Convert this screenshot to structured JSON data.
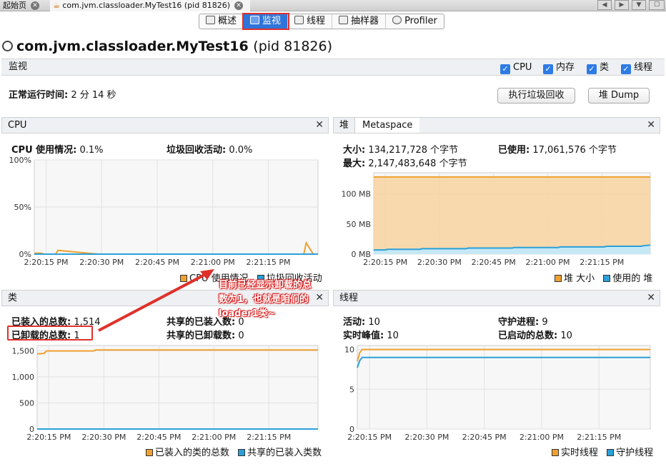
{
  "doc_tabs": [
    {
      "label": "起始页"
    },
    {
      "label": "com.jvm.classloader.MyTest16 (pid 81826)"
    }
  ],
  "view_tabs": [
    {
      "label": "概述",
      "icon": "overview-icon",
      "active": false
    },
    {
      "label": "监视",
      "icon": "monitor-icon",
      "active": true
    },
    {
      "label": "线程",
      "icon": "threads-icon",
      "active": false
    },
    {
      "label": "抽样器",
      "icon": "sampler-icon",
      "active": false
    },
    {
      "label": "Profiler",
      "icon": "profiler-icon",
      "active": false
    }
  ],
  "app": {
    "name": "com.jvm.classloader.MyTest16",
    "pid": "(pid 81826)"
  },
  "monitor": {
    "header": "监视",
    "checks": [
      {
        "label": "CPU"
      },
      {
        "label": "内存"
      },
      {
        "label": "类"
      },
      {
        "label": "线程"
      }
    ],
    "uptime_label": "正常运行时间:",
    "uptime_value": "2 分 14 秒",
    "gc_button": "执行垃圾回收",
    "dump_button": "堆 Dump"
  },
  "cpu": {
    "title": "CPU",
    "usage_label": "CPU 使用情况:",
    "usage_value": "0.1%",
    "gc_label": "垃圾回收活动:",
    "gc_value": "0.0%",
    "legend": [
      "CPU 使用情况",
      "垃圾回收活动"
    ]
  },
  "heap": {
    "tab_heap": "堆",
    "tab_meta": "Metaspace",
    "size_label": "大小:",
    "size_value": "134,217,728 个字节",
    "used_label": "已使用:",
    "used_value": "17,061,576 个字节",
    "max_label": "最大:",
    "max_value": "2,147,483,648 个字节",
    "legend": [
      "堆 大小",
      "使用的 堆"
    ]
  },
  "classes": {
    "title": "类",
    "loaded_label": "已装入的总数:",
    "loaded_value": "1,514",
    "unloaded_label": "已卸载的总数:",
    "unloaded_value": "1",
    "shared_loaded_label": "共享的已装入数:",
    "shared_loaded_value": "0",
    "shared_unloaded_label": "共享的已卸载数:",
    "shared_unloaded_value": "0",
    "legend": [
      "已装入的类的总数",
      "共享的已装入类数"
    ]
  },
  "threads": {
    "title": "线程",
    "live_label": "活动:",
    "live_value": "10",
    "peak_label": "实时峰值:",
    "peak_value": "10",
    "daemon_label": "守护进程:",
    "daemon_value": "9",
    "started_label": "已启动的总数:",
    "started_value": "10",
    "legend": [
      "实时线程",
      "守护线程"
    ]
  },
  "annotation": {
    "text": "目前已经显示卸载的总数为1，也就是咱们的loader1类~"
  },
  "colors": {
    "orange": "#f0a030",
    "blue": "#2aa0d8",
    "accent": "#2f75d9",
    "red": "#e0302a"
  },
  "chart_data": [
    {
      "id": "cpu",
      "type": "line",
      "ylim": [
        0,
        100
      ],
      "yticks": [
        "100%",
        "50%",
        "0%"
      ],
      "ytick_vals": [
        100,
        50,
        0
      ],
      "xticks": [
        "2:20:15 PM",
        "2:20:30 PM",
        "2:20:45 PM",
        "2:21:00 PM",
        "2:21:15 PM"
      ],
      "series": [
        {
          "name": "CPU 使用情况",
          "color": "#f0a030",
          "x": [
            0,
            3,
            4,
            5,
            6,
            7,
            9,
            10,
            27,
            28,
            29,
            30,
            31,
            87,
            90,
            100,
            112,
            114,
            115,
            118,
            120
          ],
          "y": [
            1,
            1,
            0,
            0,
            0,
            0,
            0,
            4,
            0,
            0,
            0,
            0,
            0,
            0,
            0,
            0,
            0,
            0,
            12,
            0,
            0
          ]
        },
        {
          "name": "垃圾回收活动",
          "color": "#2aa0d8",
          "x": [
            0,
            120
          ],
          "y": [
            0,
            0
          ]
        }
      ]
    },
    {
      "id": "heap",
      "type": "area",
      "ylim": [
        0,
        135
      ],
      "yticks": [
        "100 MB",
        "50 MB",
        "0 MB"
      ],
      "ytick_vals": [
        100,
        50,
        0
      ],
      "xticks": [
        "2:20:15 PM",
        "2:20:30 PM",
        "2:20:45 PM",
        "2:21:00 PM",
        "2:21:15 PM"
      ],
      "series": [
        {
          "name": "堆 大小",
          "color": "#f0a030",
          "x": [
            0,
            120
          ],
          "y": [
            128,
            128
          ]
        },
        {
          "name": "使用的 堆",
          "color": "#2aa0d8",
          "x": [
            0,
            5,
            6,
            20,
            21,
            40,
            41,
            60,
            61,
            80,
            81,
            100,
            101,
            116,
            117,
            120
          ],
          "y": [
            7,
            7,
            8,
            8,
            9,
            9,
            10,
            10,
            11,
            11,
            12,
            12,
            13,
            13,
            14,
            15
          ]
        }
      ]
    },
    {
      "id": "classes",
      "type": "line",
      "ylim": [
        0,
        1600
      ],
      "yticks": [
        "1,500",
        "1,000",
        "500",
        "0"
      ],
      "ytick_vals": [
        1500,
        1000,
        500,
        0
      ],
      "xticks": [
        "2:20:15 PM",
        "2:20:30 PM",
        "2:20:45 PM",
        "2:21:00 PM",
        "2:21:15 PM"
      ],
      "series": [
        {
          "name": "已装入的类的总数",
          "color": "#f0a030",
          "x": [
            0,
            3,
            4,
            24,
            25,
            120
          ],
          "y": [
            1440,
            1450,
            1495,
            1495,
            1514,
            1514
          ]
        },
        {
          "name": "共享的已装入类数",
          "color": "#2aa0d8",
          "x": [
            0,
            120
          ],
          "y": [
            0,
            0
          ]
        }
      ]
    },
    {
      "id": "threads",
      "type": "line",
      "ylim": [
        0,
        10.5
      ],
      "yticks": [
        "10",
        "5",
        "0"
      ],
      "ytick_vals": [
        10,
        5,
        0
      ],
      "xticks": [
        "2:20:15 PM",
        "2:20:30 PM",
        "2:20:45 PM",
        "2:21:00 PM",
        "2:21:15 PM"
      ],
      "series": [
        {
          "name": "实时线程",
          "color": "#f0a030",
          "x": [
            0,
            1,
            2,
            120
          ],
          "y": [
            8.5,
            9.6,
            10,
            10
          ]
        },
        {
          "name": "守护线程",
          "color": "#2aa0d8",
          "x": [
            0,
            1,
            2,
            120
          ],
          "y": [
            7.7,
            8.6,
            9,
            9
          ]
        }
      ]
    }
  ]
}
